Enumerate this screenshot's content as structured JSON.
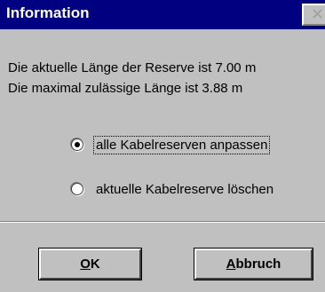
{
  "window": {
    "title": "Information",
    "close_glyph": "✕"
  },
  "message": {
    "line1": "Die aktuelle Länge der Reserve ist 7.00 m",
    "line2": "Die maximal zulässige Länge ist 3.88 m"
  },
  "options": [
    {
      "label": "alle Kabelreserven anpassen",
      "checked": true
    },
    {
      "label": "aktuelle Kabelreserve löschen",
      "checked": false
    }
  ],
  "buttons": {
    "ok": {
      "mnemonic": "O",
      "rest": "K"
    },
    "cancel": {
      "mnemonic": "A",
      "rest": "bbruch"
    }
  }
}
